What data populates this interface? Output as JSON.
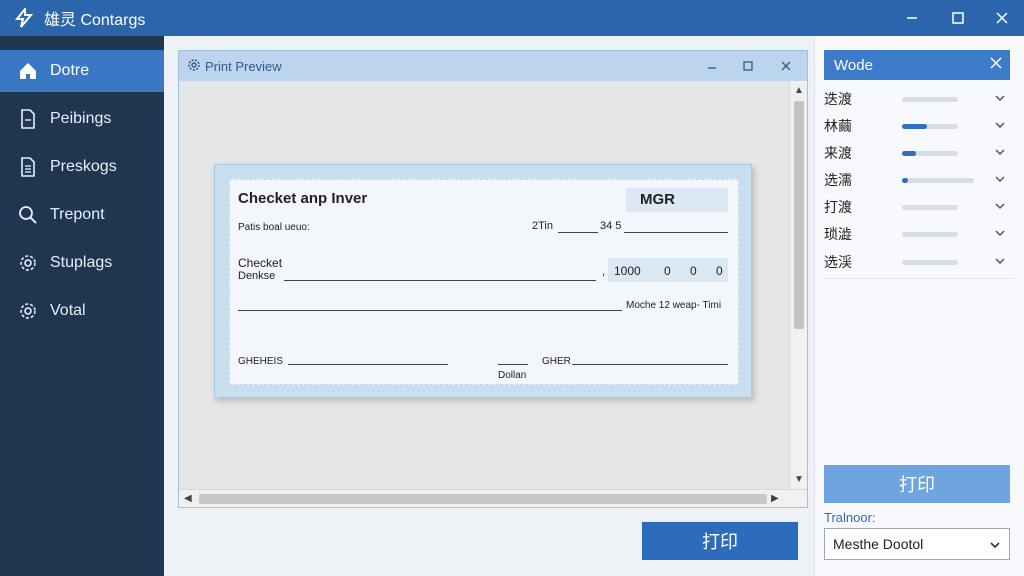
{
  "app": {
    "title": "雄灵 Contargs"
  },
  "sidebar": {
    "items": [
      {
        "label": "Dotre",
        "icon": "home-icon"
      },
      {
        "label": "Peibings",
        "icon": "document-icon"
      },
      {
        "label": "Preskogs",
        "icon": "list-document-icon"
      },
      {
        "label": "Trepont",
        "icon": "search-icon"
      },
      {
        "label": "Stuplags",
        "icon": "gear-icon"
      },
      {
        "label": "Votal",
        "icon": "gear-icon"
      }
    ]
  },
  "preview": {
    "title": "Print Preview",
    "cheque": {
      "heading": "Checket anp Inver",
      "code": "MGR",
      "sub_label": "Patis boal ueuo:",
      "date_label": "2Tin",
      "date_value": "34 5",
      "payee_label_1": "Checket",
      "payee_label_2": "Denkse",
      "amount_prefix": ",",
      "amount_values": [
        "1000",
        "0",
        "0",
        "0"
      ],
      "memo_text": "Moche 12 weap- Timi",
      "sign_left": "GHEHEIS",
      "sign_right": "GHER",
      "sign_caption": "Dollan"
    },
    "print_button": "打印"
  },
  "panel": {
    "title": "Wode",
    "settings": [
      {
        "label": "迭渡",
        "level": 0
      },
      {
        "label": "林繭",
        "level": 0.45
      },
      {
        "label": "来渡",
        "level": 0.25
      },
      {
        "label": "选濡",
        "level": 0.04
      },
      {
        "label": "打渡",
        "level": 0
      },
      {
        "label": "琐澁",
        "level": 0
      },
      {
        "label": "选渓",
        "level": 0
      }
    ],
    "print_button": "打印",
    "dropdown_label": "Tralnoor:",
    "dropdown_value": "Mesthe Dootol"
  },
  "colors": {
    "accent": "#2b66ad",
    "sidebar": "#1f3650",
    "active": "#3a78c6"
  }
}
